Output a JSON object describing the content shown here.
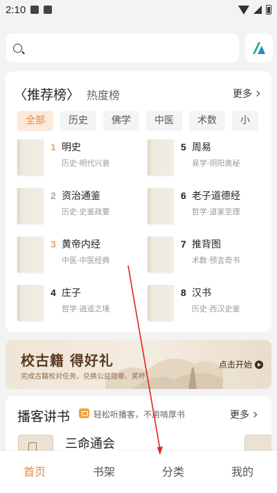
{
  "status_bar": {
    "time": "2:10"
  },
  "search": {
    "placeholder": ""
  },
  "ranking": {
    "title": "〈推荐榜〉",
    "subtitle": "热度榜",
    "more": "更多",
    "tabs": [
      "全部",
      "历史",
      "佛学",
      "中医",
      "术数",
      "小"
    ],
    "active_tab": "全部",
    "books": [
      {
        "rank": "1",
        "name": "明史",
        "tag": "历史·明代兴衰"
      },
      {
        "rank": "5",
        "name": "周易",
        "tag": "易学·阴阳奥秘"
      },
      {
        "rank": "2",
        "name": "资治通鉴",
        "tag": "历史·史鉴政要"
      },
      {
        "rank": "6",
        "name": "老子道德经",
        "tag": "哲学·道家至理"
      },
      {
        "rank": "3",
        "name": "黄帝内经",
        "tag": "中医·中医经典"
      },
      {
        "rank": "7",
        "name": "推背图",
        "tag": "术数·预言奇书"
      },
      {
        "rank": "4",
        "name": "庄子",
        "tag": "哲学·逍遥之境"
      },
      {
        "rank": "8",
        "name": "汉书",
        "tag": "历史·西汉史鉴"
      }
    ]
  },
  "banner": {
    "title": "校古籍 得好礼",
    "desc": "完成古籍校对任务，兑换公益勋章、奖杯",
    "button": "点击开始"
  },
  "podcast": {
    "title": "播客讲书",
    "subtitle": "轻松听播客，不用啃厚书",
    "more": "更多",
    "item_name": "三命通会"
  },
  "bottom_nav": {
    "items": [
      "首页",
      "书架",
      "分类",
      "我的"
    ],
    "active": "首页"
  },
  "colors": {
    "accent": "#e8883c",
    "annotation_arrow": "#e02020"
  }
}
